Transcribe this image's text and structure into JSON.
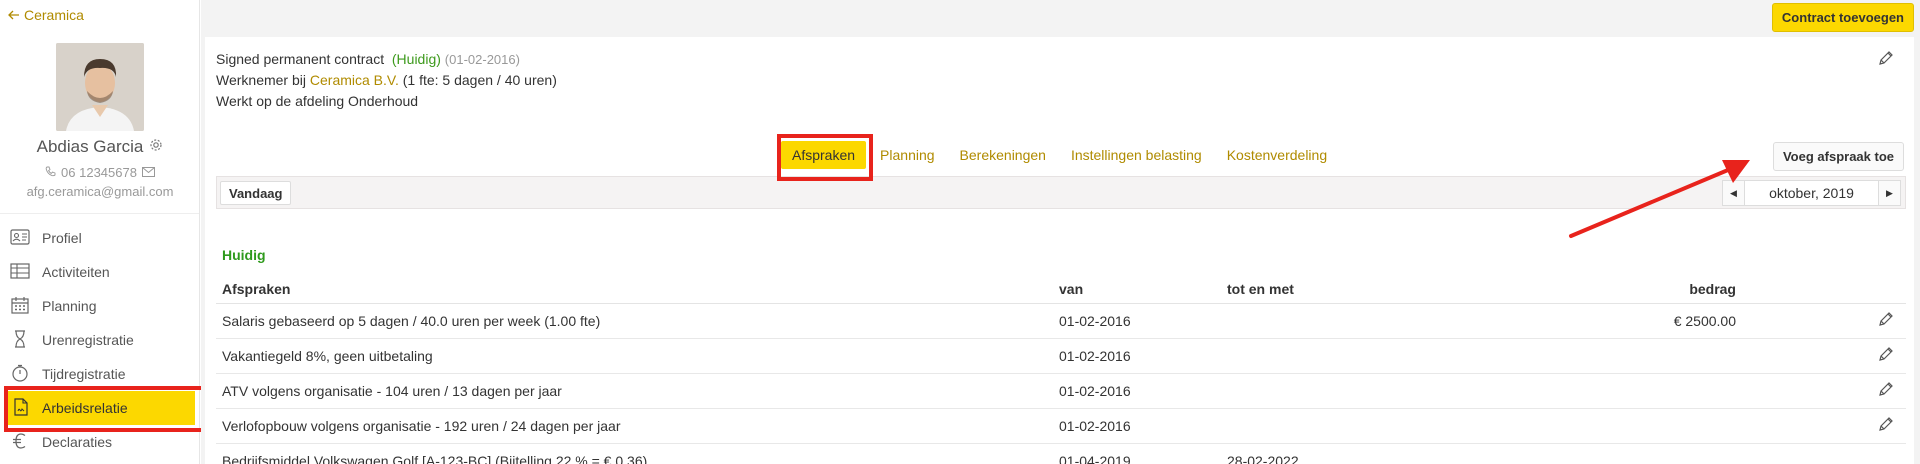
{
  "sidebar": {
    "back_label": "Ceramica",
    "employee": {
      "name": "Abdias Garcia",
      "phone": "06 12345678",
      "email": "afg.ceramica@gmail.com"
    },
    "items": [
      {
        "label": "Profiel",
        "icon": "id-card-icon"
      },
      {
        "label": "Activiteiten",
        "icon": "table-icon"
      },
      {
        "label": "Planning",
        "icon": "calendar-icon"
      },
      {
        "label": "Urenregistratie",
        "icon": "hourglass-icon"
      },
      {
        "label": "Tijdregistratie",
        "icon": "stopwatch-icon"
      },
      {
        "label": "Arbeidsrelatie",
        "icon": "contract-icon",
        "active": true
      },
      {
        "label": "Declaraties",
        "icon": "euro-icon"
      }
    ]
  },
  "header": {
    "add_contract_label": "Contract toevoegen"
  },
  "contract": {
    "type": "Signed permanent contract",
    "status": "(Huidig)",
    "start": "(01-02-2016)",
    "employer_prefix": "Werknemer bij",
    "employer": "Ceramica B.V.",
    "fte": "(1 fte: 5 dagen / 40 uren)",
    "department": "Werkt op de afdeling Onderhoud"
  },
  "tabs": [
    {
      "label": "Afspraken",
      "active": true
    },
    {
      "label": "Planning"
    },
    {
      "label": "Berekeningen"
    },
    {
      "label": "Instellingen belasting"
    },
    {
      "label": "Kostenverdeling"
    }
  ],
  "add_agreement_label": "Voeg afspraak toe",
  "datebar": {
    "today_label": "Vandaag",
    "month": "oktober, 2019"
  },
  "section_title": "Huidig",
  "table": {
    "headers": {
      "desc": "Afspraken",
      "from": "van",
      "to": "tot en met",
      "amount": "bedrag"
    },
    "rows": [
      {
        "desc": "Salaris gebaseerd op 5 dagen / 40.0 uren per week (1.00 fte)",
        "from": "01-02-2016",
        "to": "",
        "amount": "€ 2500.00"
      },
      {
        "desc": "Vakantiegeld 8%, geen uitbetaling",
        "from": "01-02-2016",
        "to": "",
        "amount": ""
      },
      {
        "desc": "ATV volgens organisatie - 104 uren / 13 dagen per jaar",
        "from": "01-02-2016",
        "to": "",
        "amount": ""
      },
      {
        "desc": "Verlofopbouw volgens organisatie - 192 uren / 24 dagen per jaar",
        "from": "01-02-2016",
        "to": "",
        "amount": ""
      },
      {
        "desc": "Bedrijfsmiddel Volkswagen Golf [A-123-BC] (Bijtelling 22 % = € 0.36)",
        "from": "01-04-2019",
        "to": "28-02-2022",
        "amount": ""
      }
    ]
  },
  "colors": {
    "accent": "#fcd800",
    "link": "#b08b00",
    "status_green": "#3d9a1c",
    "highlight": "#e8231c"
  }
}
